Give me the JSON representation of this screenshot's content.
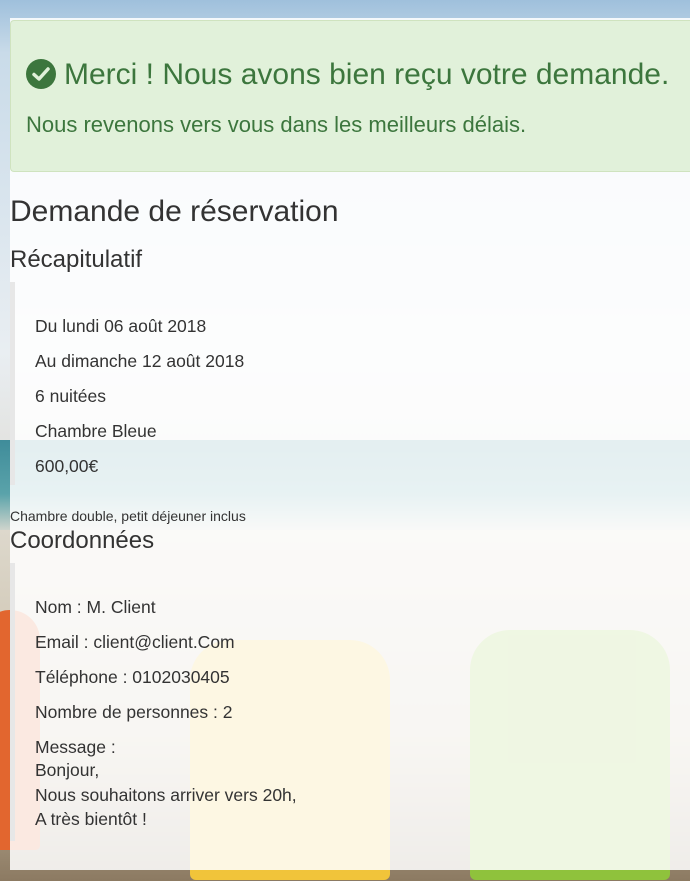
{
  "alert": {
    "title": "Merci ! Nous avons bien reçu votre demande.",
    "subtitle": "Nous revenons vers vous dans les meilleurs délais.",
    "icon": "check-circle-icon"
  },
  "page": {
    "heading": "Demande de réservation"
  },
  "recap": {
    "heading": "Récapitulatif",
    "lines": [
      "Du lundi 06 août 2018",
      "Au dimanche 12 août 2018",
      "6 nuitées",
      "Chambre Bleue",
      "600,00€"
    ],
    "note": "Chambre double, petit déjeuner inclus"
  },
  "contact": {
    "heading": "Coordonnées",
    "lines": [
      "Nom : M. Client",
      "Email : client@client.Com",
      "Téléphone : 0102030405",
      "Nombre de personnes : 2",
      "Message :",
      "Bonjour,",
      "Nous souhaitons arriver vers 20h,",
      "A très bientôt !"
    ]
  },
  "colors": {
    "success_bg": "#dff0d8",
    "success_text": "#3c763d"
  }
}
